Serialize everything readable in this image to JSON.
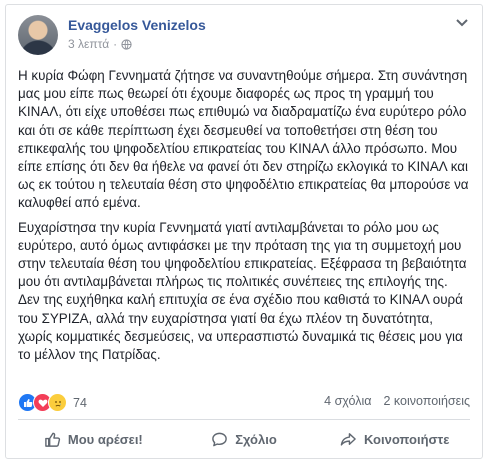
{
  "post": {
    "author": "Evaggelos Venizelos",
    "time": "3 λεπτά",
    "separator": "·",
    "paragraphs": [
      "Η κυρία Φώφη Γεννηματά ζήτησε να συναντηθούμε σήμερα. Στη συνάντηση μας μου είπε πως θεωρεί ότι έχουμε διαφορές ως προς τη γραμμή του ΚΙΝΑΛ, ότι είχε υποθέσει πως επιθυμώ να διαδραματίζω ένα ευρύτερο ρόλο και ότι σε κάθε περίπτωση έχει δεσμευθεί να τοποθετήσει στη θέση του επικεφαλής του ψηφοδελτίου επικρατείας του ΚΙΝΑΛ άλλο πρόσωπο. Μου είπε επίσης ότι δεν θα ήθελε να φανεί ότι δεν στηρίζω εκλογικά το ΚΙΝΑΛ και ως εκ τούτου η τελευταία θέση στο ψηφοδέλτιο επικρατείας θα μπορούσε να καλυφθεί από εμένα.",
      "Ευχαρίστησα την κυρία Γεννηματά γιατί αντιλαμβάνεται το ρόλο μου ως ευρύτερο, αυτό όμως αντιφάσκει με την πρόταση της για τη συμμετοχή μου στην τελευταία θέση του ψηφοδελτίου επικρατείας. Εξέφρασα τη βεβαιότητα μου ότι αντιλαμβάνεται πλήρως τις πολιτικές συνέπειες της επιλογής της. Δεν της ευχήθηκα καλή επιτυχία σε ένα σχέδιο που καθιστά το ΚΙΝΑΛ ουρά του ΣΥΡΙΖΑ, αλλά την ευχαρίστησα γιατί θα έχω πλέον τη δυνατότητα, χωρίς κομματικές δεσμεύσεις, να υπερασπιστώ δυναμικά τις θέσεις μου για το μέλλον της Πατρίδας."
    ]
  },
  "stats": {
    "reaction_count": "74",
    "comments": "4 σχόλια",
    "shares": "2 κοινοποιήσεις"
  },
  "actions": {
    "like": "Μου αρέσει!",
    "comment": "Σχόλιο",
    "share": "Κοινοποιήστε"
  },
  "icons": {
    "like": "like-icon",
    "love": "love-icon",
    "sad": "sad-icon",
    "globe": "globe-icon",
    "chevron": "chevron-down-icon"
  },
  "colors": {
    "author": "#365899",
    "like_blue": "#2078f4",
    "love_red": "#f33e58",
    "sad_yellow": "#fbcd3c",
    "muted": "#606770"
  }
}
